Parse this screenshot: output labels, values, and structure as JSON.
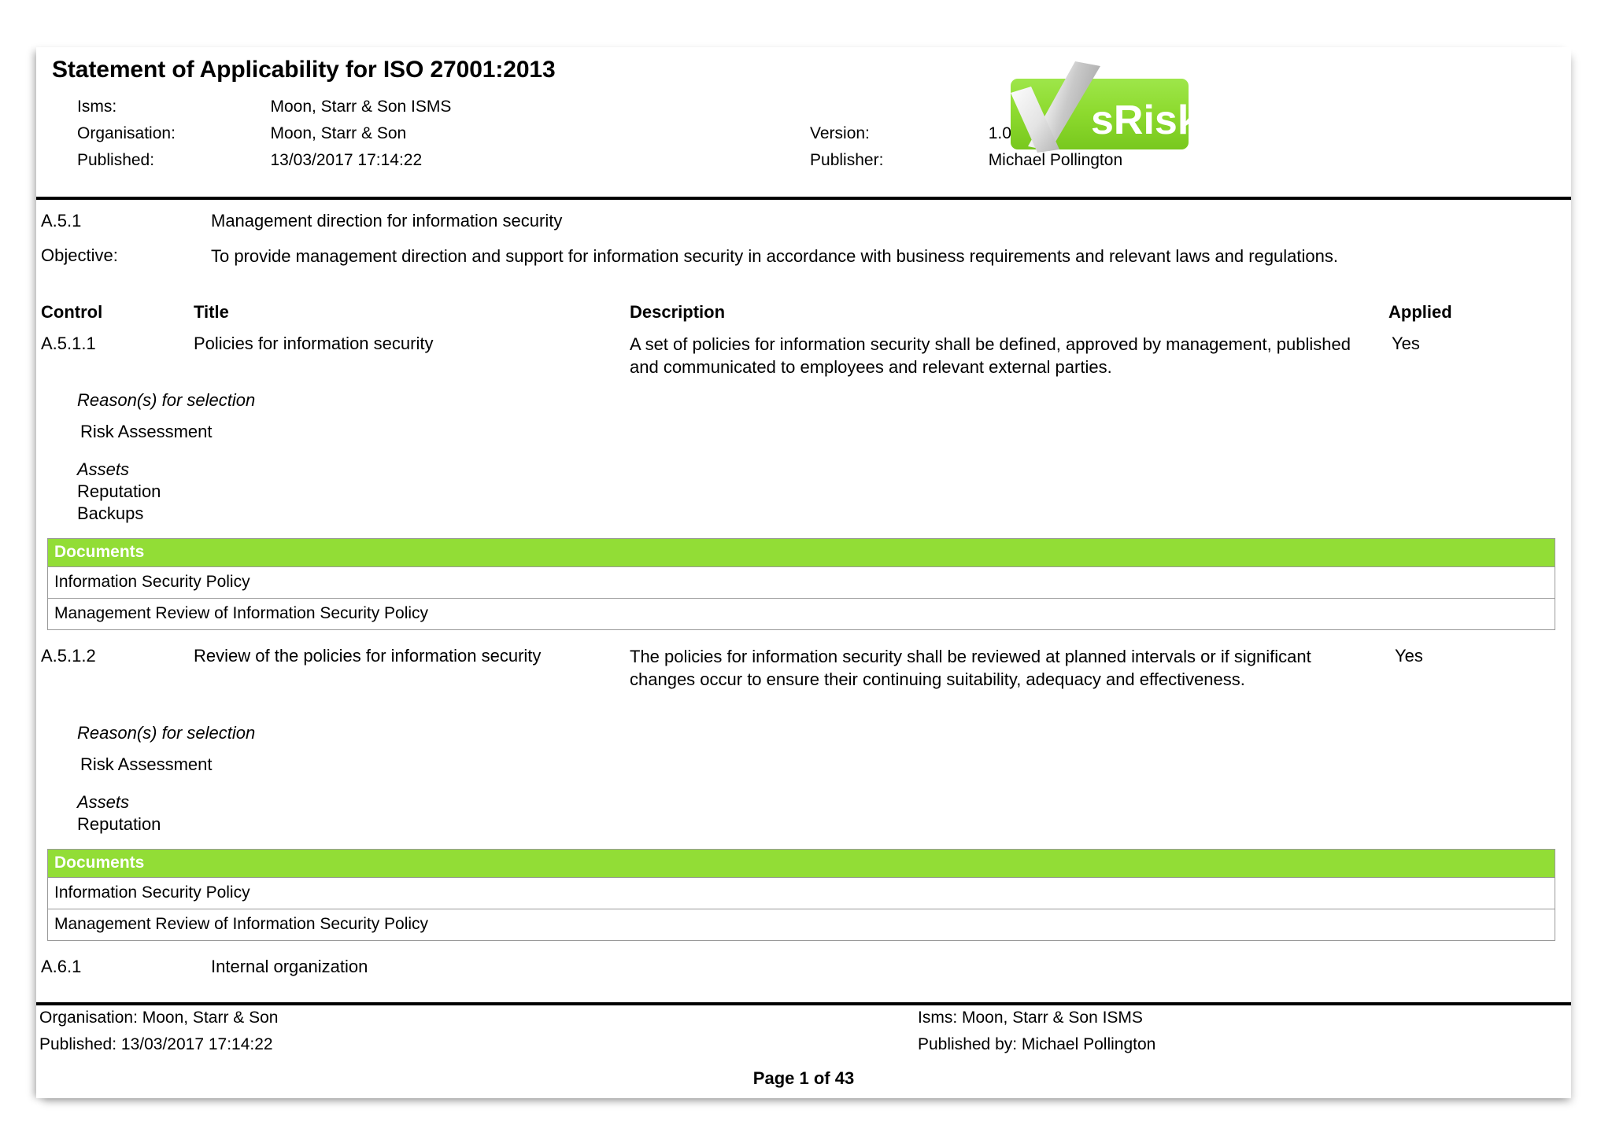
{
  "document": {
    "title": "Statement of Applicability for ISO 27001:2013",
    "meta": {
      "isms_label": "Isms:",
      "isms_value": "Moon, Starr & Son ISMS",
      "organisation_label": "Organisation:",
      "organisation_value": "Moon, Starr & Son",
      "published_label": "Published:",
      "published_value": "13/03/2017 17:14:22",
      "version_label": "Version:",
      "version_value": "1.0",
      "publisher_label": "Publisher:",
      "publisher_value": "Michael Pollington"
    },
    "logo": {
      "name": "vsrisk-logo",
      "text": "sRisk",
      "mark": "V",
      "green": "#92DD36"
    }
  },
  "sections": {
    "a51": {
      "code": "A.5.1",
      "name": "Management direction for information security",
      "objective_label": "Objective:",
      "objective_text": "To provide management direction and support for information security in accordance with business requirements and relevant laws and regulations."
    },
    "a61": {
      "code": "A.6.1",
      "name": "Internal organization"
    }
  },
  "columns": {
    "control": "Control",
    "title": "Title",
    "description": "Description",
    "applied": "Applied"
  },
  "labels": {
    "reasons": "Reason(s) for selection",
    "assets": "Assets",
    "documents": "Documents"
  },
  "controls": [
    {
      "code": "A.5.1.1",
      "title": "Policies for information security",
      "description": "A set of policies for information security shall be defined, approved by management, published and communicated to employees and relevant external parties.",
      "applied": "Yes",
      "reasons": [
        "Risk Assessment"
      ],
      "assets": [
        "Reputation",
        "Backups"
      ],
      "documents": [
        "Information Security Policy",
        "Management Review of Information Security Policy"
      ]
    },
    {
      "code": "A.5.1.2",
      "title": "Review of the policies for information security",
      "description": "The policies for information security shall be reviewed at planned intervals or if significant changes occur to ensure their continuing suitability, adequacy and effectiveness.",
      "applied": "Yes",
      "reasons": [
        "Risk Assessment"
      ],
      "assets": [
        "Reputation"
      ],
      "documents": [
        "Information Security Policy",
        "Management Review of Information Security Policy"
      ]
    }
  ],
  "footer": {
    "organisation": "Organisation:  Moon, Starr & Son",
    "published": "Published: 13/03/2017 17:14:22",
    "isms": "Isms:  Moon, Starr & Son ISMS",
    "published_by": "Published by: Michael Pollington",
    "page": "Page 1 of 43"
  }
}
